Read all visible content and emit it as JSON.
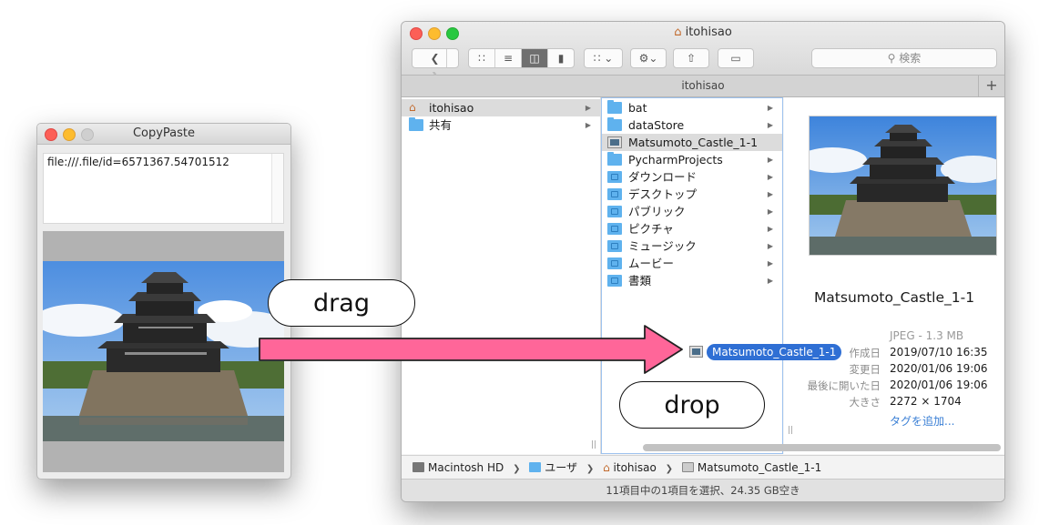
{
  "copypaste": {
    "title": "CopyPaste",
    "text_content": "file:///.file/id=6571367.54701512"
  },
  "finder": {
    "title": "itohisao",
    "search_placeholder": "検索",
    "path_tab": "itohisao",
    "sidebar_column": [
      {
        "label": "itohisao",
        "icon": "home-icon",
        "selected": true
      },
      {
        "label": "共有",
        "icon": "folder-icon",
        "selected": false
      }
    ],
    "files_column": [
      {
        "label": "bat",
        "icon": "folder-icon",
        "has_children": true
      },
      {
        "label": "dataStore",
        "icon": "folder-icon",
        "has_children": true
      },
      {
        "label": "Matsumoto_Castle_1-1",
        "icon": "image-file-icon",
        "has_children": false,
        "selected": true
      },
      {
        "label": "PycharmProjects",
        "icon": "folder-icon",
        "has_children": true
      },
      {
        "label": "ダウンロード",
        "icon": "downloads-folder-icon",
        "has_children": true
      },
      {
        "label": "デスクトップ",
        "icon": "desktop-folder-icon",
        "has_children": true
      },
      {
        "label": "パブリック",
        "icon": "public-folder-icon",
        "has_children": true
      },
      {
        "label": "ピクチャ",
        "icon": "pictures-folder-icon",
        "has_children": true
      },
      {
        "label": "ミュージック",
        "icon": "music-folder-icon",
        "has_children": true
      },
      {
        "label": "ムービー",
        "icon": "movies-folder-icon",
        "has_children": true
      },
      {
        "label": "書類",
        "icon": "documents-folder-icon",
        "has_children": true
      }
    ],
    "preview": {
      "name": "Matsumoto_Castle_1-1",
      "kind": "JPEG - 1.3 MB",
      "info": [
        {
          "label": "作成日",
          "value": "2019/07/10 16:35"
        },
        {
          "label": "変更日",
          "value": "2020/01/06 19:06"
        },
        {
          "label": "最後に開いた日",
          "value": "2020/01/06 19:06"
        },
        {
          "label": "大きさ",
          "value": "2272 × 1704"
        }
      ],
      "add_tags": "タグを追加..."
    },
    "path_bar": [
      "Macintosh HD",
      "ユーザ",
      "itohisao",
      "Matsumoto_Castle_1-1"
    ],
    "status": "11項目中の1項目を選択、24.35 GB空き",
    "drag_ghost_label": "Matsumoto_Castle_1-1"
  },
  "annotations": {
    "drag": "drag",
    "drop": "drop",
    "arrow_color": "#ff6699"
  }
}
